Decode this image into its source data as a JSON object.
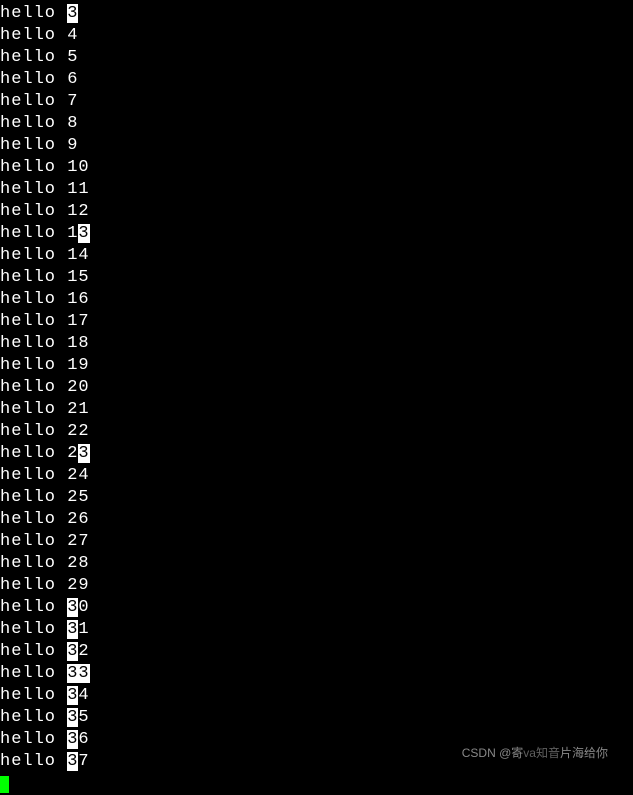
{
  "terminal": {
    "lines": [
      {
        "prefix": "hello ",
        "plain1": "",
        "highlight": "3",
        "plain2": ""
      },
      {
        "prefix": "hello ",
        "plain1": "4",
        "highlight": "",
        "plain2": ""
      },
      {
        "prefix": "hello ",
        "plain1": "5",
        "highlight": "",
        "plain2": ""
      },
      {
        "prefix": "hello ",
        "plain1": "6",
        "highlight": "",
        "plain2": ""
      },
      {
        "prefix": "hello ",
        "plain1": "7",
        "highlight": "",
        "plain2": ""
      },
      {
        "prefix": "hello ",
        "plain1": "8",
        "highlight": "",
        "plain2": ""
      },
      {
        "prefix": "hello ",
        "plain1": "9",
        "highlight": "",
        "plain2": ""
      },
      {
        "prefix": "hello ",
        "plain1": "10",
        "highlight": "",
        "plain2": ""
      },
      {
        "prefix": "hello ",
        "plain1": "11",
        "highlight": "",
        "plain2": ""
      },
      {
        "prefix": "hello ",
        "plain1": "12",
        "highlight": "",
        "plain2": ""
      },
      {
        "prefix": "hello ",
        "plain1": "1",
        "highlight": "3",
        "plain2": ""
      },
      {
        "prefix": "hello ",
        "plain1": "14",
        "highlight": "",
        "plain2": ""
      },
      {
        "prefix": "hello ",
        "plain1": "15",
        "highlight": "",
        "plain2": ""
      },
      {
        "prefix": "hello ",
        "plain1": "16",
        "highlight": "",
        "plain2": ""
      },
      {
        "prefix": "hello ",
        "plain1": "17",
        "highlight": "",
        "plain2": ""
      },
      {
        "prefix": "hello ",
        "plain1": "18",
        "highlight": "",
        "plain2": ""
      },
      {
        "prefix": "hello ",
        "plain1": "19",
        "highlight": "",
        "plain2": ""
      },
      {
        "prefix": "hello ",
        "plain1": "20",
        "highlight": "",
        "plain2": ""
      },
      {
        "prefix": "hello ",
        "plain1": "21",
        "highlight": "",
        "plain2": ""
      },
      {
        "prefix": "hello ",
        "plain1": "22",
        "highlight": "",
        "plain2": ""
      },
      {
        "prefix": "hello ",
        "plain1": "2",
        "highlight": "3",
        "plain2": ""
      },
      {
        "prefix": "hello ",
        "plain1": "24",
        "highlight": "",
        "plain2": ""
      },
      {
        "prefix": "hello ",
        "plain1": "25",
        "highlight": "",
        "plain2": ""
      },
      {
        "prefix": "hello ",
        "plain1": "26",
        "highlight": "",
        "plain2": ""
      },
      {
        "prefix": "hello ",
        "plain1": "27",
        "highlight": "",
        "plain2": ""
      },
      {
        "prefix": "hello ",
        "plain1": "28",
        "highlight": "",
        "plain2": ""
      },
      {
        "prefix": "hello ",
        "plain1": "29",
        "highlight": "",
        "plain2": ""
      },
      {
        "prefix": "hello ",
        "plain1": "",
        "highlight": "3",
        "plain2": "0"
      },
      {
        "prefix": "hello ",
        "plain1": "",
        "highlight": "3",
        "plain2": "1"
      },
      {
        "prefix": "hello ",
        "plain1": "",
        "highlight": "3",
        "plain2": "2"
      },
      {
        "prefix": "hello ",
        "plain1": "",
        "highlight": "33",
        "plain2": ""
      },
      {
        "prefix": "hello ",
        "plain1": "",
        "highlight": "3",
        "plain2": "4"
      },
      {
        "prefix": "hello ",
        "plain1": "",
        "highlight": "3",
        "plain2": "5"
      },
      {
        "prefix": "hello ",
        "plain1": "",
        "highlight": "3",
        "plain2": "6"
      },
      {
        "prefix": "hello ",
        "plain1": "",
        "highlight": "3",
        "plain2": "7"
      }
    ]
  },
  "watermark": {
    "text1": "CSDN @寄",
    "text2": "片海给你",
    "faint": "va知音"
  }
}
